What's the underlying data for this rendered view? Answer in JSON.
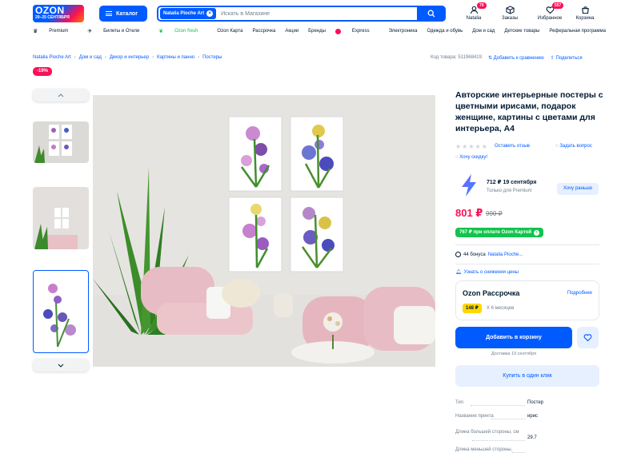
{
  "header": {
    "logo_text": "OZON",
    "logo_promo": "20–25 СЕНТЯБРЯ",
    "catalog_label": "Каталог",
    "search_chip": "Natalia Pioche Art",
    "search_placeholder": "Искать в Магазине",
    "profile_label": "Natalia",
    "profile_badge": "79",
    "orders_label": "Заказы",
    "favorites_label": "Избранное",
    "favorites_badge": "557",
    "cart_label": "Корзина"
  },
  "menu": [
    "Premium",
    "Билеты и Отели",
    "Ozon fresh",
    "Ozon Карта",
    "Рассрочка",
    "Акции",
    "Бренды",
    "Express",
    "Электроника",
    "Одежда и обувь",
    "Дом и сад",
    "Детские товары",
    "Реферальная программа"
  ],
  "breadcrumbs": [
    "Natalia Pioche Art",
    "Дом и сад",
    "Декор и интерьер",
    "Картины и панно",
    "Постеры"
  ],
  "product_code": "Код товара: 511968419",
  "compare_label": "Добавить к сравнению",
  "share_label": "Поделиться",
  "discount_badge": "-19%",
  "product": {
    "title": "Авторские интерьерные постеры с цветными ирисами, подарок женщине, картины с цветами для интерьера, А4",
    "review_link": "Оставить отзыв",
    "question_link": "Задать вопрос",
    "want_discount": "Хочу скидку!",
    "premium_price": "712 ₽ 19 сентября",
    "premium_sub": "Только для Premium",
    "premium_button": "Хочу раньше",
    "price": "801 ₽",
    "old_price": "990 ₽",
    "ozon_card_price": "767 ₽ при оплате Ozon Картой",
    "bonus_text": "44 бонуса",
    "bonus_seller": "Natalia Pioche...",
    "price_alert": "Узнать о снижении цены",
    "installment_title": "Ozon Рассрочка",
    "installment_more": "Подробнее",
    "installment_amount": "148 ₽",
    "installment_months": "Х 6 месяцев",
    "add_to_cart": "Добавить в корзину",
    "delivery": "Доставка 19 сентября",
    "one_click": "Купить в один клик"
  },
  "specs": [
    {
      "key": "Тип",
      "value": "Постер"
    },
    {
      "key": "Название принта",
      "value": "ирис"
    },
    {
      "key": "Длина большей стороны, см",
      "value": "29.7"
    },
    {
      "key": "Длина меньшей стороны,",
      "value": ""
    }
  ],
  "colors": {
    "brand": "#005bff",
    "sale": "#f91155",
    "card": "#10c44c"
  }
}
